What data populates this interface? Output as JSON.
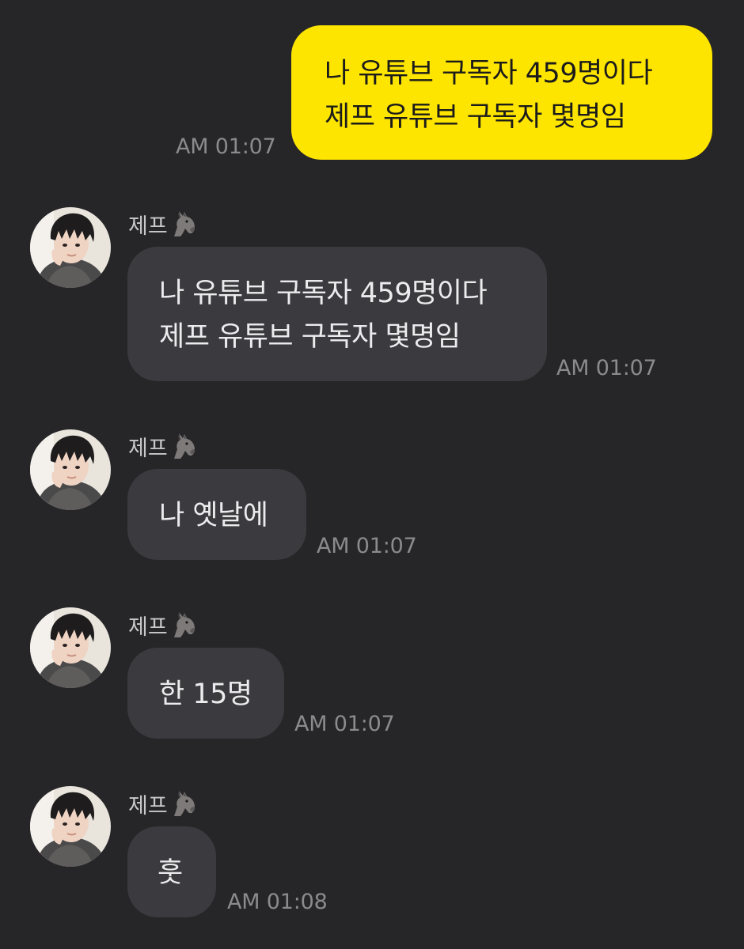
{
  "colors": {
    "background": "#262528",
    "outgoing_bubble": "#FEE500",
    "incoming_bubble": "#3B3A3E",
    "timestamp": "#8B8A8E"
  },
  "outgoing": {
    "lines": [
      "나 유튜브 구독자 459명이다",
      "제프 유튜브 구독자 몇명임"
    ],
    "time": "AM 01:07"
  },
  "incoming": [
    {
      "sender": "제프",
      "sender_emoji": "donkey-icon",
      "lines": [
        "나 유튜브 구독자 459명이다",
        "제프 유튜브 구독자 몇명임"
      ],
      "time": "AM 01:07"
    },
    {
      "sender": "제프",
      "sender_emoji": "donkey-icon",
      "lines": [
        "나 옛날에"
      ],
      "time": "AM 01:07"
    },
    {
      "sender": "제프",
      "sender_emoji": "donkey-icon",
      "lines": [
        "한 15명"
      ],
      "time": "AM 01:07"
    },
    {
      "sender": "제프",
      "sender_emoji": "donkey-icon",
      "lines": [
        "훗"
      ],
      "time": "AM 01:08"
    }
  ]
}
